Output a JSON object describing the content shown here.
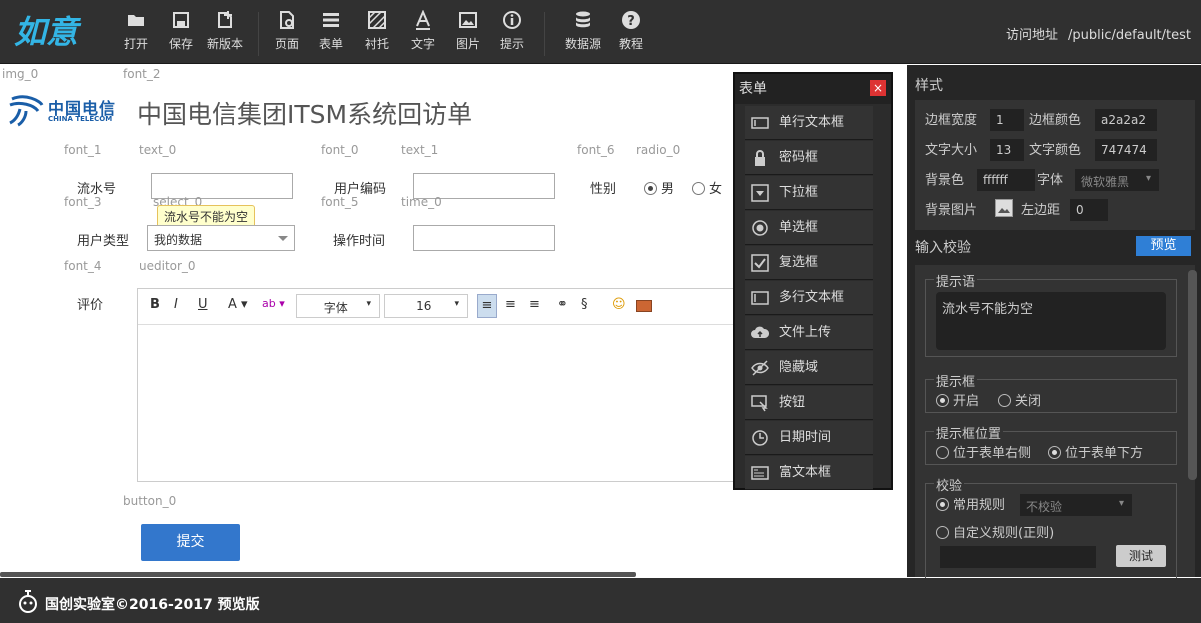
{
  "toolbar": {
    "logo": "如意",
    "buttons": [
      {
        "label": "打开",
        "icon": "folder-icon"
      },
      {
        "label": "保存",
        "icon": "save-icon"
      },
      {
        "label": "新版本",
        "icon": "new-version-icon"
      },
      {
        "label": "页面",
        "icon": "page-icon"
      },
      {
        "label": "表单",
        "icon": "form-icon"
      },
      {
        "label": "衬托",
        "icon": "background-icon"
      },
      {
        "label": "文字",
        "icon": "text-icon"
      },
      {
        "label": "图片",
        "icon": "image-icon"
      },
      {
        "label": "提示",
        "icon": "info-icon"
      },
      {
        "label": "数据源",
        "icon": "database-icon"
      },
      {
        "label": "教程",
        "icon": "help-icon"
      }
    ],
    "address_label": "访问地址",
    "address_value": "/public/default/test"
  },
  "canvas": {
    "tags": {
      "img_0": "img_0",
      "font_2": "font_2",
      "font_1": "font_1",
      "text_0": "text_0",
      "font_0": "font_0",
      "text_1": "text_1",
      "font_6": "font_6",
      "radio_0": "radio_0",
      "font_3": "font_3",
      "select_0": "select_0",
      "font_5": "font_5",
      "time_0": "time_0",
      "font_4": "font_4",
      "ueditor_0": "ueditor_0",
      "button_0": "button_0"
    },
    "logo_cn": "中国电信",
    "logo_en": "CHINA TELECOM",
    "title": "中国电信集团ITSM系统回访单",
    "serial_label": "流水号",
    "user_code_label": "用户编码",
    "gender_label": "性别",
    "gender_male": "男",
    "gender_female": "女",
    "tooltip": "流水号不能为空",
    "user_type_label": "用户类型",
    "user_type_value": "我的数据",
    "op_time_label": "操作时间",
    "comment_label": "评价",
    "editor": {
      "font": "字体",
      "size": "16"
    },
    "submit": "提交"
  },
  "form_panel": {
    "title": "表单",
    "close": "×",
    "items": [
      {
        "label": "单行文本框",
        "icon": "textbox-icon"
      },
      {
        "label": "密码框",
        "icon": "lock-icon"
      },
      {
        "label": "下拉框",
        "icon": "dropdown-icon"
      },
      {
        "label": "单选框",
        "icon": "radio-icon"
      },
      {
        "label": "复选框",
        "icon": "checkbox-icon"
      },
      {
        "label": "多行文本框",
        "icon": "textarea-icon"
      },
      {
        "label": "文件上传",
        "icon": "upload-icon"
      },
      {
        "label": "隐藏域",
        "icon": "hidden-icon"
      },
      {
        "label": "按钮",
        "icon": "button-icon"
      },
      {
        "label": "日期时间",
        "icon": "clock-icon"
      },
      {
        "label": "富文本框",
        "icon": "richtext-icon"
      }
    ]
  },
  "sidebar": {
    "style_title": "样式",
    "border_width_label": "边框宽度",
    "border_width": "1",
    "border_color_label": "边框颜色",
    "border_color": "a2a2a2",
    "font_size_label": "文字大小",
    "font_size": "13",
    "font_color_label": "文字颜色",
    "font_color": "747474",
    "bg_color_label": "背景色",
    "bg_color": "ffffff",
    "font_family_label": "字体",
    "font_family": "微软雅黑",
    "bg_image_label": "背景图片",
    "margin_left_label": "左边距",
    "margin_left": "0",
    "validation_title": "输入校验",
    "preview": "预览",
    "hint_title": "提示语",
    "hint_text": "流水号不能为空",
    "hintbox_title": "提示框",
    "hintbox_on": "开启",
    "hintbox_off": "关闭",
    "hintpos_title": "提示框位置",
    "hintpos_right": "位于表单右侧",
    "hintpos_below": "位于表单下方",
    "verify_title": "校验",
    "common_rule": "常用规则",
    "common_rule_value": "不校验",
    "custom_rule": "自定义规则(正则)",
    "test": "测试"
  },
  "footer": {
    "text": "国创实验室©2016-2017 预览版"
  },
  "colors": {
    "accent": "#3377cc",
    "brand": "#33b5e5",
    "close": "#dd3333"
  }
}
